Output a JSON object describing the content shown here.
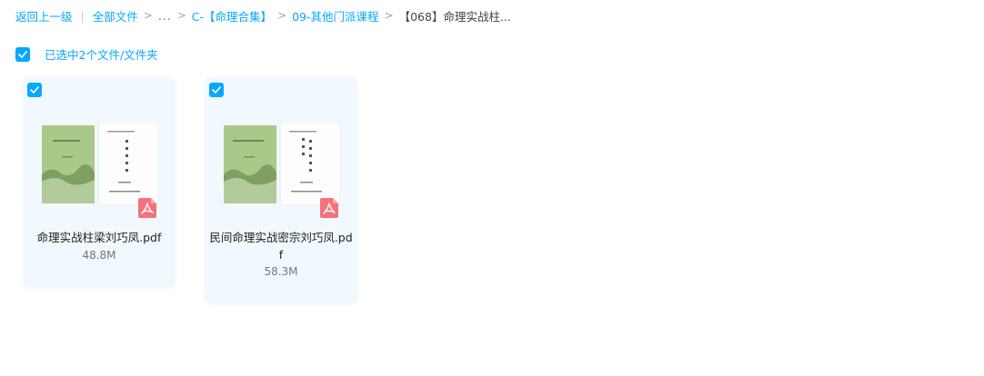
{
  "breadcrumb": {
    "back": "返回上一级",
    "all_files": "全部文件",
    "ellipsis": "...",
    "path1": "C-【命理合集】",
    "path2": "09-其他门派课程",
    "current": "【068】命理实战柱..."
  },
  "selection": {
    "label": "已选中2个文件/文件夹"
  },
  "files": [
    {
      "name": "命理实战柱梁刘巧凤.pdf",
      "size": "48.8M"
    },
    {
      "name": "民间命理实战密宗刘巧凤.pdf",
      "size": "58.3M"
    }
  ],
  "colors": {
    "accent": "#06a7ff",
    "card_bg": "#f1f9fe",
    "pdf_red": "#f5727a"
  }
}
